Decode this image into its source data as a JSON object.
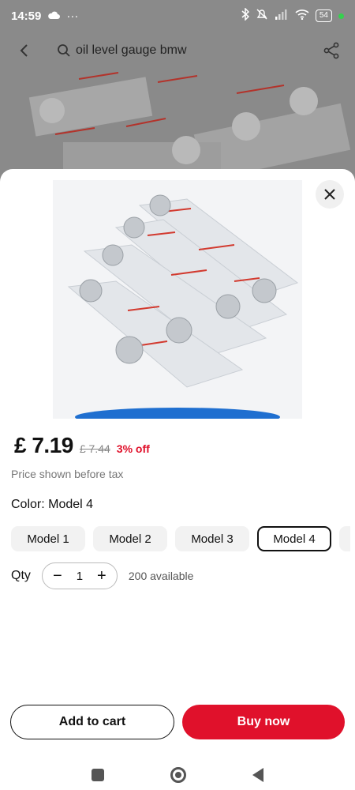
{
  "status_bar": {
    "time": "14:59",
    "more": "···",
    "battery": "54"
  },
  "header": {
    "search_text": "oil level gauge bmw"
  },
  "product": {
    "price": "£ 7.19",
    "old_price": "£ 7.44",
    "discount": "3% off",
    "tax_note": "Price shown before tax"
  },
  "color": {
    "label": "Color: Model 4",
    "options": [
      "Model 1",
      "Model 2",
      "Model 3",
      "Model 4"
    ],
    "selected": "Model 4"
  },
  "quantity": {
    "label": "Qty",
    "value": "1",
    "minus": "−",
    "plus": "+",
    "available": "200 available"
  },
  "actions": {
    "add_to_cart": "Add to cart",
    "buy_now": "Buy now"
  },
  "colors": {
    "accent": "#e0112b",
    "discount": "#e0102a"
  }
}
